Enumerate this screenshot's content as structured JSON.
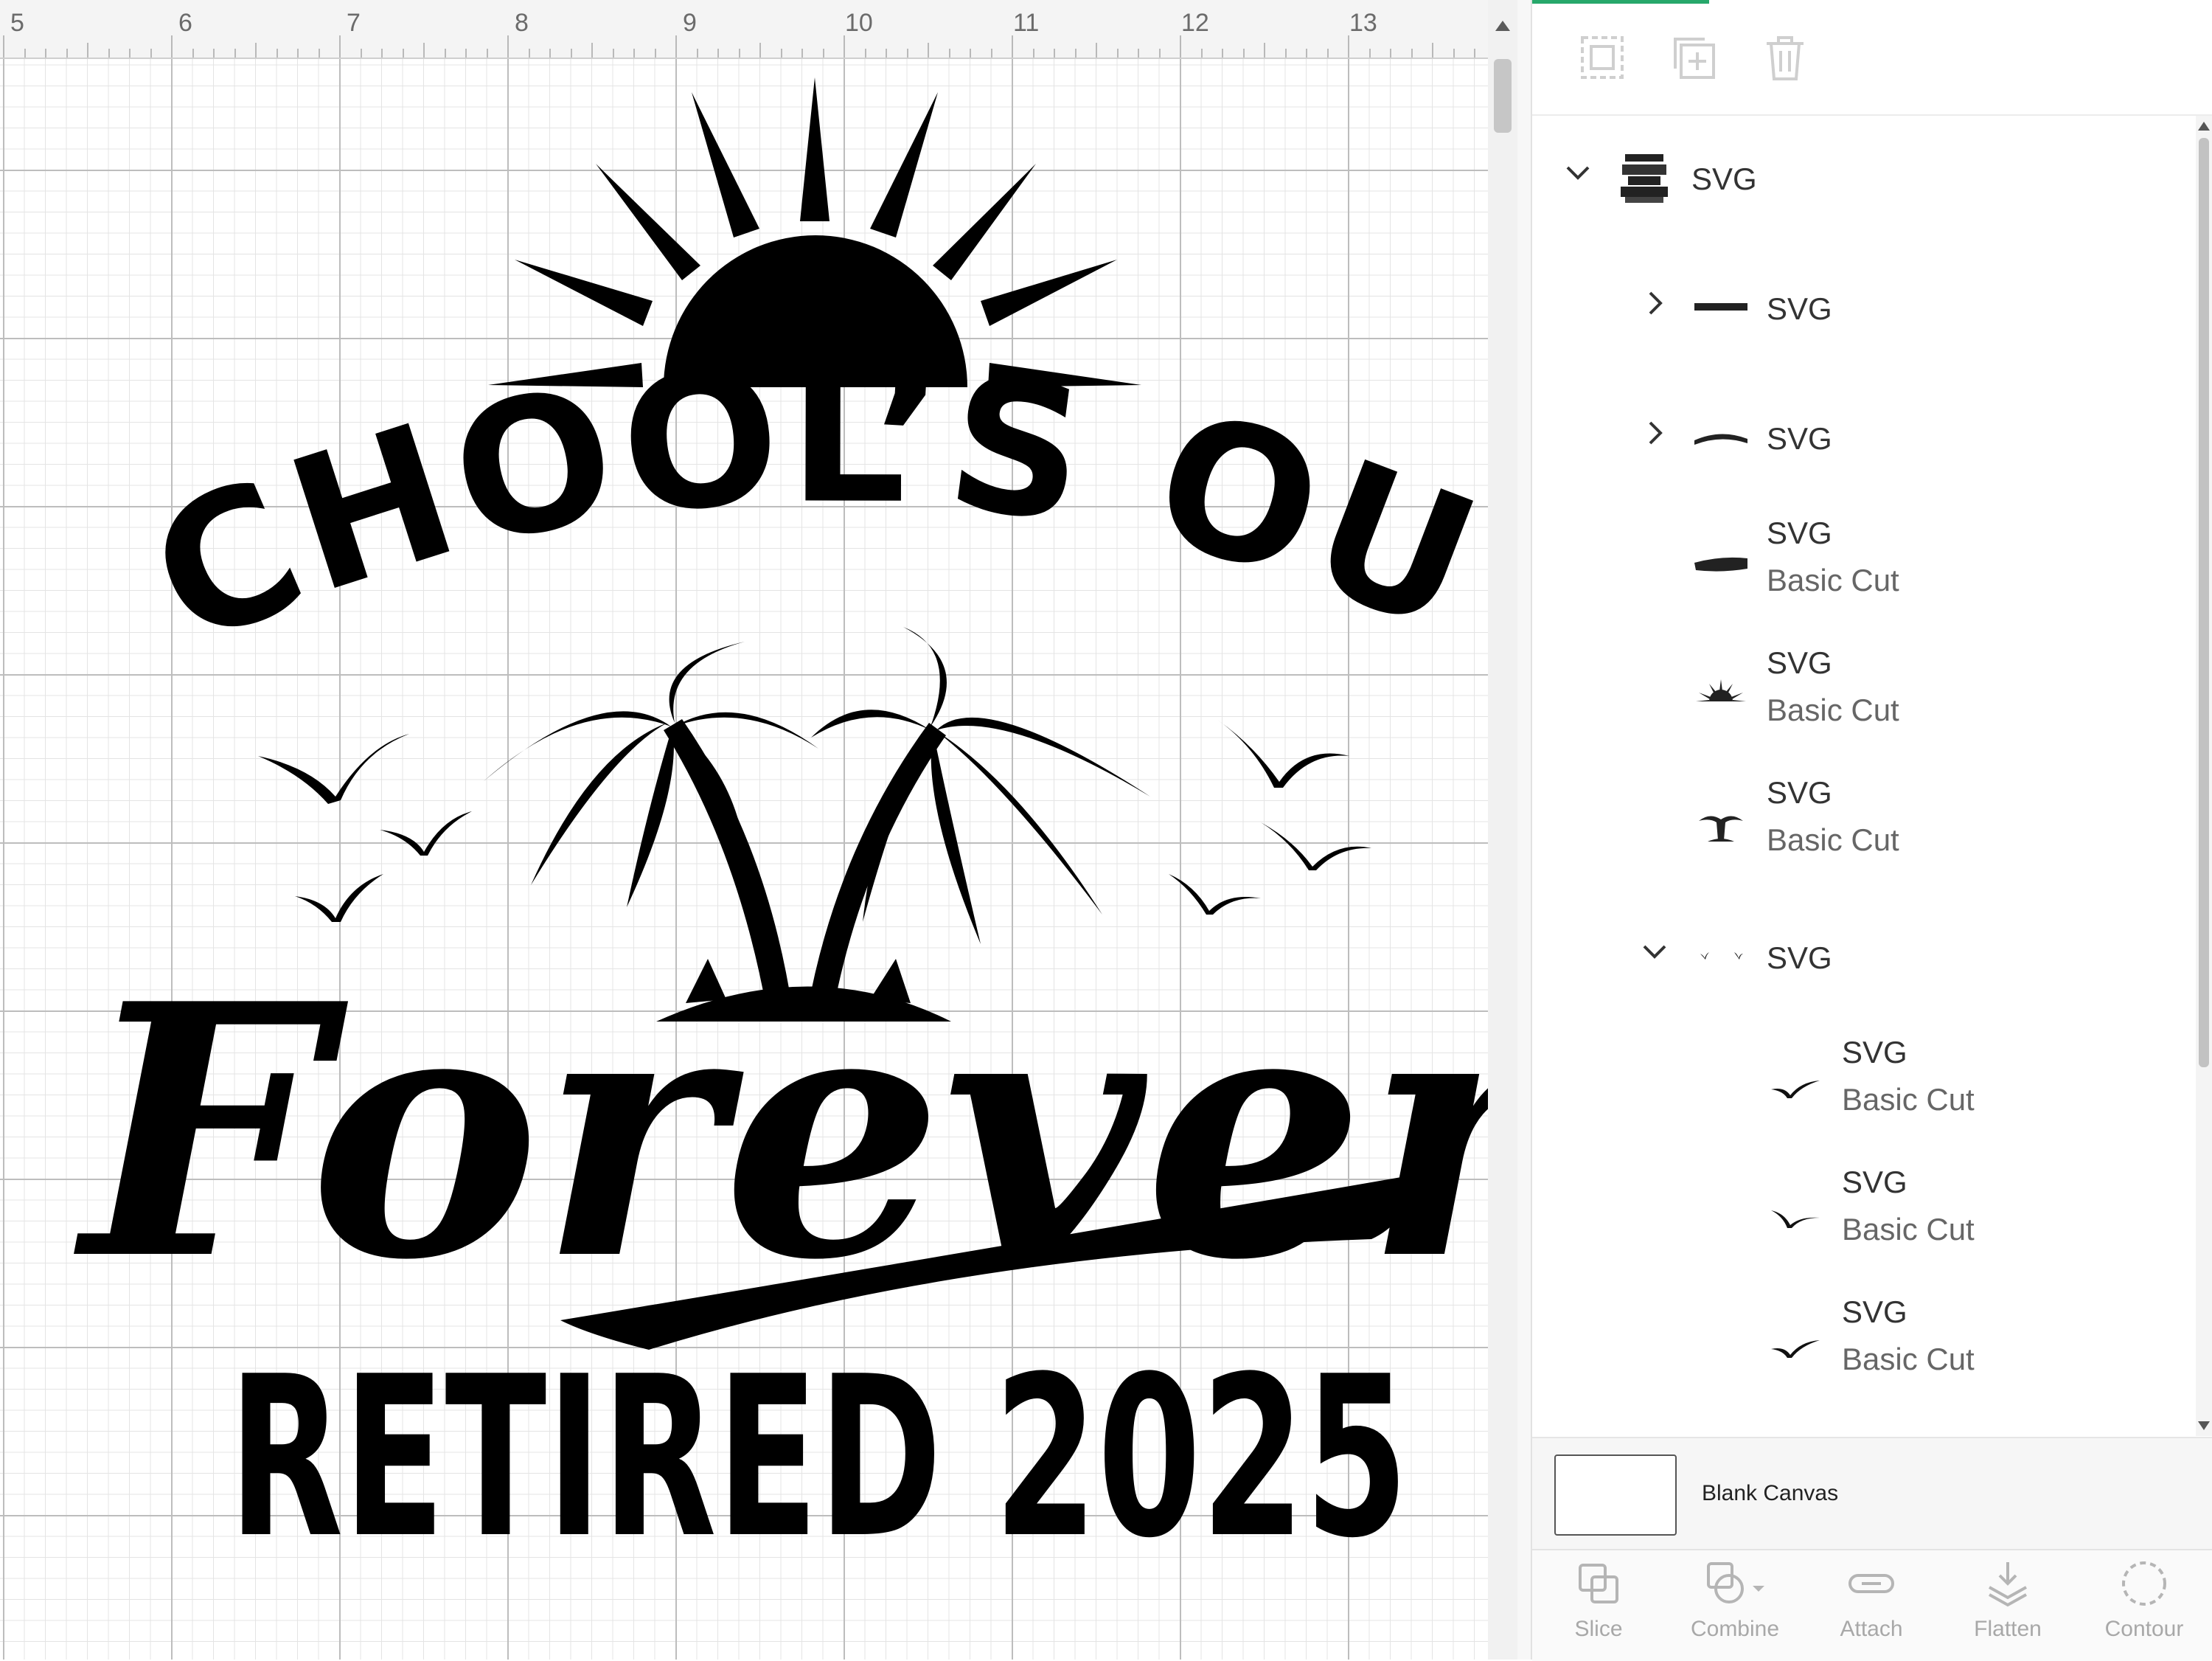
{
  "ruler": {
    "labels": [
      "5",
      "6",
      "7",
      "8",
      "9",
      "10",
      "11",
      "12",
      "13"
    ]
  },
  "design": {
    "line1": "SCHOOL’S OUT",
    "line2": "Forever",
    "line3": "RETIRED 2025"
  },
  "toolbar": {
    "group_icon": "group-icon",
    "duplicate_icon": "duplicate-icon",
    "delete_icon": "trash-icon"
  },
  "layers": [
    {
      "name": "SVG",
      "sub": "",
      "expand": "down",
      "thumb": "full-design-thumb"
    },
    {
      "name": "SVG",
      "sub": "",
      "expand": "right",
      "thumb": "retired-text-thumb"
    },
    {
      "name": "SVG",
      "sub": "",
      "expand": "right",
      "thumb": "schools-out-text-thumb"
    },
    {
      "name": "SVG",
      "sub": "Basic Cut",
      "expand": "none",
      "thumb": "forever-text-thumb"
    },
    {
      "name": "SVG",
      "sub": "Basic Cut",
      "expand": "none",
      "thumb": "sun-thumb"
    },
    {
      "name": "SVG",
      "sub": "Basic Cut",
      "expand": "none",
      "thumb": "palm-trees-thumb"
    },
    {
      "name": "SVG",
      "sub": "",
      "expand": "down",
      "thumb": "birds-group-thumb"
    },
    {
      "name": "SVG",
      "sub": "Basic Cut",
      "expand": "none",
      "thumb": "bird-thumb"
    },
    {
      "name": "SVG",
      "sub": "Basic Cut",
      "expand": "none",
      "thumb": "bird-thumb"
    },
    {
      "name": "SVG",
      "sub": "Basic Cut",
      "expand": "none",
      "thumb": "bird-thumb"
    }
  ],
  "blank_canvas": {
    "label": "Blank Canvas"
  },
  "bottom_bar": {
    "slice": "Slice",
    "combine": "Combine",
    "attach": "Attach",
    "flatten": "Flatten",
    "contour": "Contour"
  },
  "colors": {
    "accent": "#27a86b",
    "ink": "#000000",
    "grid": "#bdbdbd"
  }
}
